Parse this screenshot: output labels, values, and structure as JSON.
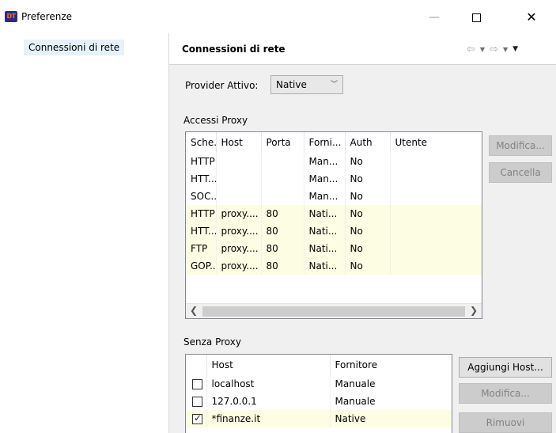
{
  "window": {
    "title": "Preferenze",
    "app_icon_text": "DT",
    "minimize_glyph": "—",
    "close_glyph": "✕"
  },
  "nav": {
    "items": [
      {
        "label": "Connessioni di rete",
        "selected": true
      }
    ]
  },
  "pane": {
    "title": "Connessioni di rete",
    "nav_icons": [
      "back-arrow-icon",
      "back-dropdown-icon",
      "forward-arrow-icon",
      "forward-dropdown-icon",
      "view-menu-icon"
    ]
  },
  "provider": {
    "label": "Provider Attivo:",
    "selected": "Native"
  },
  "proxy_entries": {
    "label": "Accessi Proxy",
    "columns": [
      "Sche...",
      "Host",
      "Porta",
      "Forni...",
      "Auth",
      "Utente"
    ],
    "rows": [
      {
        "cells": [
          "HTTP",
          "",
          "",
          "Man...",
          "No",
          ""
        ],
        "native": false
      },
      {
        "cells": [
          "HTT...",
          "",
          "",
          "Man...",
          "No",
          ""
        ],
        "native": false
      },
      {
        "cells": [
          "SOC...",
          "",
          "",
          "Man...",
          "No",
          ""
        ],
        "native": false
      },
      {
        "cells": [
          "HTTP",
          "proxy....",
          "80",
          "Nati...",
          "No",
          ""
        ],
        "native": true
      },
      {
        "cells": [
          "HTT...",
          "proxy....",
          "80",
          "Nati...",
          "No",
          ""
        ],
        "native": true
      },
      {
        "cells": [
          "FTP",
          "proxy....",
          "80",
          "Nati...",
          "No",
          ""
        ],
        "native": true
      },
      {
        "cells": [
          "GOP...",
          "proxy....",
          "80",
          "Nati...",
          "No",
          ""
        ],
        "native": true
      }
    ],
    "buttons": {
      "edit": "Modifica...",
      "clear": "Cancella"
    }
  },
  "bypass": {
    "label": "Senza Proxy",
    "columns": [
      "Host",
      "Fornitore"
    ],
    "rows": [
      {
        "checked": false,
        "host": "localhost",
        "provider": "Manuale",
        "native": false
      },
      {
        "checked": false,
        "host": "127.0.0.1",
        "provider": "Manuale",
        "native": false
      },
      {
        "checked": true,
        "host": "*finanze.it",
        "provider": "Native",
        "native": true
      }
    ],
    "buttons": {
      "add": "Aggiungi Host...",
      "edit": "Modifica...",
      "remove": "Rimuovi"
    }
  },
  "colors": {
    "native_row": "#fdfde3",
    "selection": "#e5f1fb",
    "pane_bg": "#f0f0f0"
  }
}
